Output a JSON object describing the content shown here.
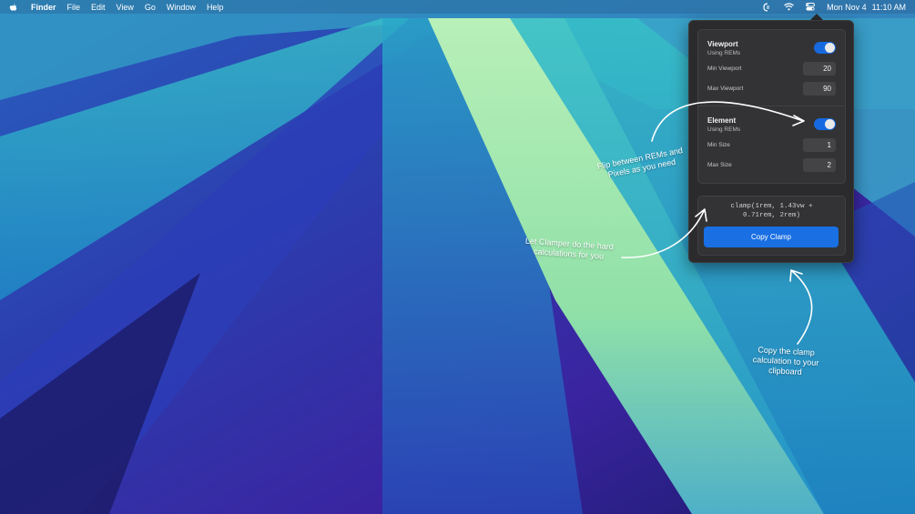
{
  "menubar": {
    "apple_icon": "apple-logo-icon",
    "app_name": "Finder",
    "items": [
      "File",
      "Edit",
      "View",
      "Go",
      "Window",
      "Help"
    ],
    "status_icons": [
      "clamper-menu-icon",
      "wifi-icon",
      "control-center-icon"
    ],
    "date": "Mon Nov 4",
    "time": "11:10 AM"
  },
  "panel": {
    "viewport": {
      "title": "Viewport",
      "subtitle": "Using REMs",
      "toggle_on": true,
      "min_label": "Min Viewport",
      "min_value": "20",
      "max_label": "Max Viewport",
      "max_value": "90"
    },
    "element": {
      "title": "Element",
      "subtitle": "Using REMs",
      "toggle_on": true,
      "min_label": "Min Size",
      "min_value": "1",
      "max_label": "Max Size",
      "max_value": "2"
    },
    "output": {
      "line1": "clamp(1rem, 1.43vw +",
      "line2": "0.71rem, 2rem)",
      "copy_label": "Copy Clamp"
    }
  },
  "annotations": {
    "flip_line1": "Flip between REMs and",
    "flip_line2": "Pixels as you need",
    "let_line1": "Let Clamper do the hard",
    "let_line2": "calculations for you",
    "copy_line1": "Copy the clamp",
    "copy_line2": "calculation to your",
    "copy_line3": "clipboard"
  },
  "colors": {
    "accent": "#1a6fe3",
    "panel_bg": "#2b2b2d"
  }
}
